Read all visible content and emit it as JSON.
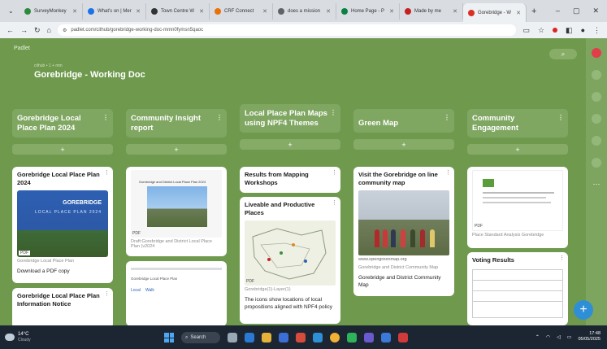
{
  "browser": {
    "tabs": [
      {
        "label": "SurveyMonkey",
        "color": "#2b8a3e"
      },
      {
        "label": "What's on | Mer",
        "color": "#1a73e8"
      },
      {
        "label": "Town Centre W",
        "color": "#333333"
      },
      {
        "label": "CRF Connect",
        "color": "#e8710a"
      },
      {
        "label": "does a mission",
        "color": "#5f6368"
      },
      {
        "label": "Home Page - P",
        "color": "#0b8043"
      },
      {
        "label": "Made by me",
        "color": "#c5221f"
      },
      {
        "label": "Gorebridge - W",
        "color": "#d93025",
        "active": true
      }
    ],
    "url": "padlet.com/cithub/gorebridge-working-doc-mmn0fymsn5qaoc"
  },
  "padlet": {
    "brand": "Padlet",
    "meta": "cithub • 1 + mm",
    "title": "Gorebridge - Working Doc",
    "add_label": "+",
    "sections": [
      {
        "title": "Gorebridge Local Place Plan 2024"
      },
      {
        "title": "Community Insight report"
      },
      {
        "title": "Local Place Plan Maps using NPF4 Themes"
      },
      {
        "title": "Green Map"
      },
      {
        "title": "Community Engagement"
      }
    ],
    "cards": {
      "c1_title": "Gorebridge Local Place Plan 2024",
      "c1_thumb_title": "GOREBRIDGE",
      "c1_thumb_sub": "LOCAL PLACE PLAN 2024",
      "c1_pdf": "PDF",
      "c1_caption": "Gorebridge Local Place Plan",
      "c1_body": "Download a PDF copy",
      "c2_title": "Gorebridge Local Place Plan Information Notice",
      "c3_doc_title": "Gorebridge and District Local Place Plan 2024",
      "c3_pdf": "PDF",
      "c3_caption": "Draft:Gorebridge and District Local Place Plan (v2024",
      "c4_text": "Gorebridge Local Place Plan",
      "c4_link_a": "Local",
      "c4_link_b": "Walk",
      "c5_title": "Results from Mapping Workshops",
      "c6_title": "Liveable and Productive Places",
      "c6_pdf": "PDF",
      "c6_caption": "Gorebridge(1)-Layer(1)",
      "c6_body": "The icons show locations of local propositions aligned with NPF4 policy",
      "c7_title": "Visit the Gorebridge on line community map",
      "c7_site": "www.opengreenmap.org",
      "c7_caption": "Gorebridge and District Community Map",
      "c7_body": "Gorebridge and District Community Map",
      "c8_pdf": "PDF",
      "c8_caption": "Place Standard Analysis Gorebridge",
      "c9_title": "Voting Results"
    }
  },
  "taskbar": {
    "temp": "14°C",
    "condition": "Cloudy",
    "search": "Search",
    "time": "17:48",
    "date": "05/05/2025"
  }
}
